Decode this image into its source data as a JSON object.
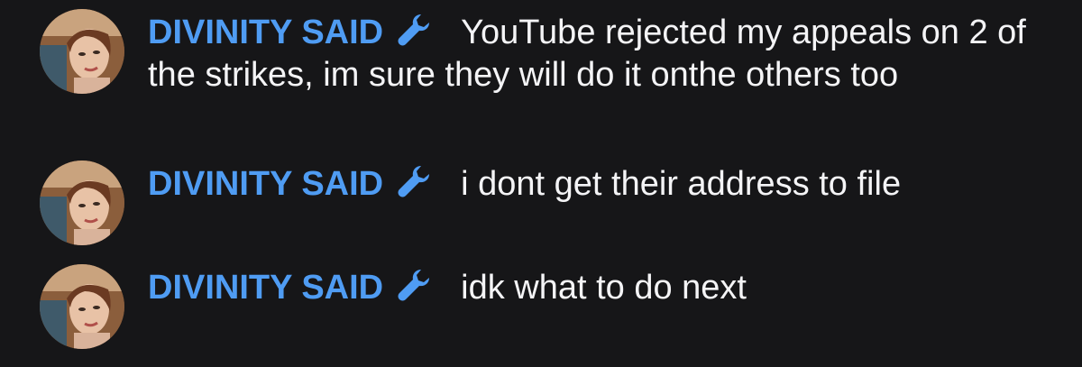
{
  "messages": [
    {
      "author": "DIVINITY SAID",
      "role_icon": "wrench-icon",
      "text": "YouTube rejected my appeals on 2 of the strikes, im sure they will do it onthe others too"
    },
    {
      "author": "DIVINITY SAID",
      "role_icon": "wrench-icon",
      "text": "i dont get their address to file"
    },
    {
      "author": "DIVINITY SAID",
      "role_icon": "wrench-icon",
      "text": "idk what to do next"
    }
  ],
  "colors": {
    "background": "#161618",
    "author": "#4f9cf3",
    "icon": "#4f9cf3",
    "text": "#f4f4f6"
  }
}
